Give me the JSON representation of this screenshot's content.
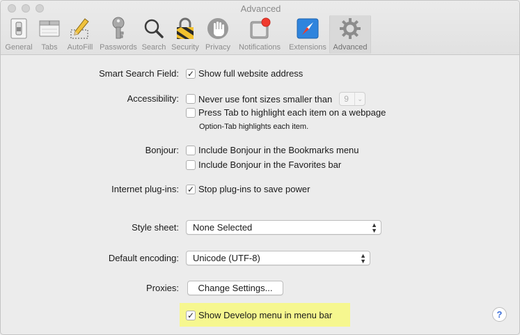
{
  "window": {
    "title": "Advanced"
  },
  "toolbar": {
    "tabs": [
      {
        "label": "General",
        "icon": "general-icon"
      },
      {
        "label": "Tabs",
        "icon": "tabs-icon"
      },
      {
        "label": "AutoFill",
        "icon": "autofill-icon"
      },
      {
        "label": "Passwords",
        "icon": "key-icon"
      },
      {
        "label": "Search",
        "icon": "search-icon"
      },
      {
        "label": "Security",
        "icon": "lock-icon"
      },
      {
        "label": "Privacy",
        "icon": "hand-icon"
      },
      {
        "label": "Notifications",
        "icon": "notifications-icon"
      },
      {
        "label": "Extensions",
        "icon": "compass-icon"
      },
      {
        "label": "Advanced",
        "icon": "gear-icon"
      }
    ],
    "active_tab": "Advanced"
  },
  "settings": {
    "smart_search": {
      "label": "Smart Search Field:",
      "option": "Show full website address",
      "checked": true
    },
    "accessibility": {
      "label": "Accessibility:",
      "font_option": "Never use font sizes smaller than",
      "font_size": "9",
      "tab_option": "Press Tab to highlight each item on a webpage",
      "note": "Option-Tab highlights each item."
    },
    "bonjour": {
      "label": "Bonjour:",
      "bookmarks_option": "Include Bonjour in the Bookmarks menu",
      "favorites_option": "Include Bonjour in the Favorites bar"
    },
    "plugins": {
      "label": "Internet plug-ins:",
      "option": "Stop plug-ins to save power",
      "checked": true
    },
    "style_sheet": {
      "label": "Style sheet:",
      "value": "None Selected"
    },
    "encoding": {
      "label": "Default encoding:",
      "value": "Unicode (UTF-8)"
    },
    "proxies": {
      "label": "Proxies:",
      "button": "Change Settings..."
    },
    "develop": {
      "option": "Show Develop menu in menu bar",
      "checked": true
    },
    "help": {
      "glyph": "?"
    },
    "check_glyph": "✓"
  },
  "colors": {
    "highlight": "#f6f78f",
    "accent": "#3d6fd8"
  }
}
